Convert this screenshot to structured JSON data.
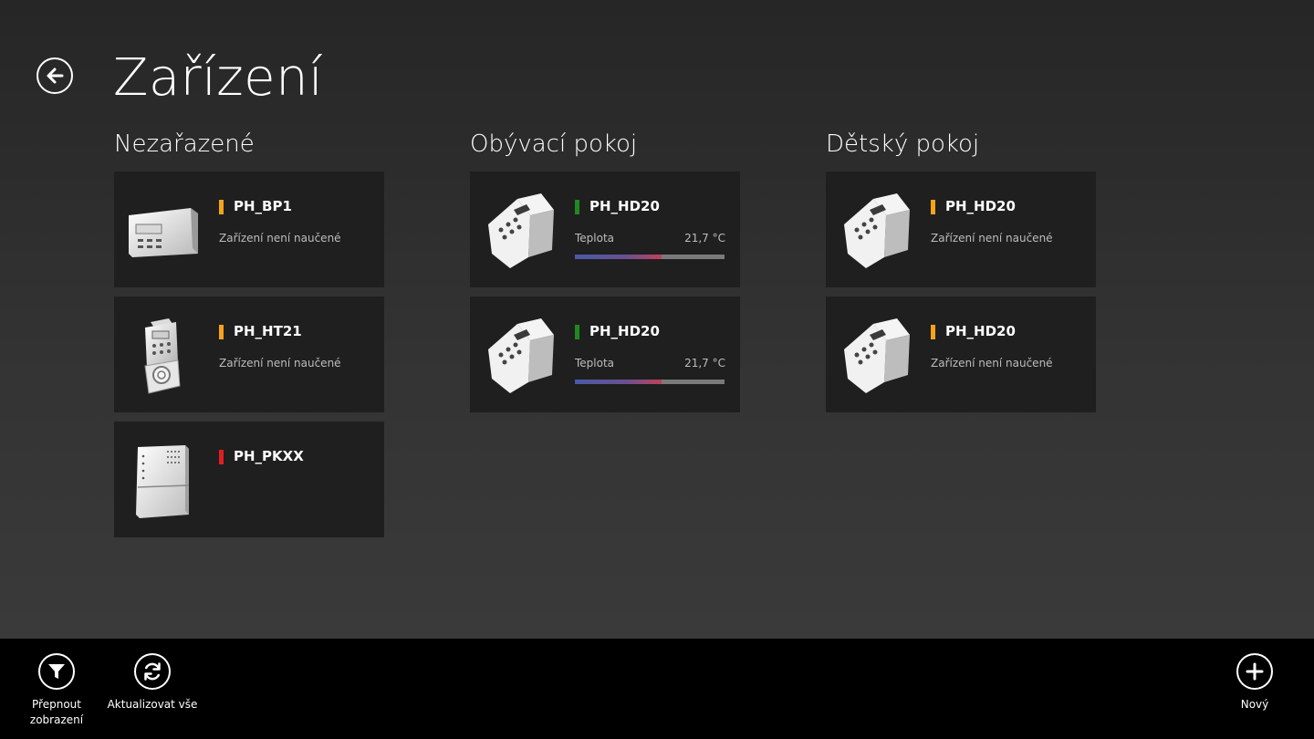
{
  "header": {
    "title": "Zařízení",
    "back_icon": "back-arrow-icon"
  },
  "groups": [
    {
      "title": "Nezařazené",
      "devices": [
        {
          "name": "PH_BP1",
          "status_color": "#f5a31a",
          "state": "Zařízení není naučené",
          "icon": "base-station-device-icon"
        },
        {
          "name": "PH_HT21",
          "status_color": "#f5a31a",
          "state": "Zařízení není naučené",
          "icon": "wall-thermostat-device-icon"
        },
        {
          "name": "PH_PKXX",
          "status_color": "#e01f1f",
          "state": "",
          "icon": "boiler-switch-device-icon"
        }
      ]
    },
    {
      "title": "Obývací pokoj",
      "devices": [
        {
          "name": "PH_HD20",
          "status_color": "#1e8a1e",
          "temp_label": "Teplota",
          "temp_value": "21,7 °C",
          "temp_fraction": 0.58,
          "icon": "radiator-head-device-icon"
        },
        {
          "name": "PH_HD20",
          "status_color": "#1e8a1e",
          "temp_label": "Teplota",
          "temp_value": "21,7 °C",
          "temp_fraction": 0.58,
          "icon": "radiator-head-device-icon"
        }
      ]
    },
    {
      "title": "Dětský pokoj",
      "devices": [
        {
          "name": "PH_HD20",
          "status_color": "#f5a31a",
          "state": "Zařízení není naučené",
          "icon": "radiator-head-device-icon"
        },
        {
          "name": "PH_HD20",
          "status_color": "#f5a31a",
          "state": "Zařízení není naučené",
          "icon": "radiator-head-device-icon"
        }
      ]
    }
  ],
  "appbar": {
    "switch_view": {
      "label_line1": "Přepnout",
      "label_line2": "zobrazení",
      "icon": "filter-icon"
    },
    "refresh_all": {
      "label": "Aktualizovat vše",
      "icon": "refresh-icon"
    },
    "new": {
      "label": "Nový",
      "icon": "plus-icon"
    }
  }
}
